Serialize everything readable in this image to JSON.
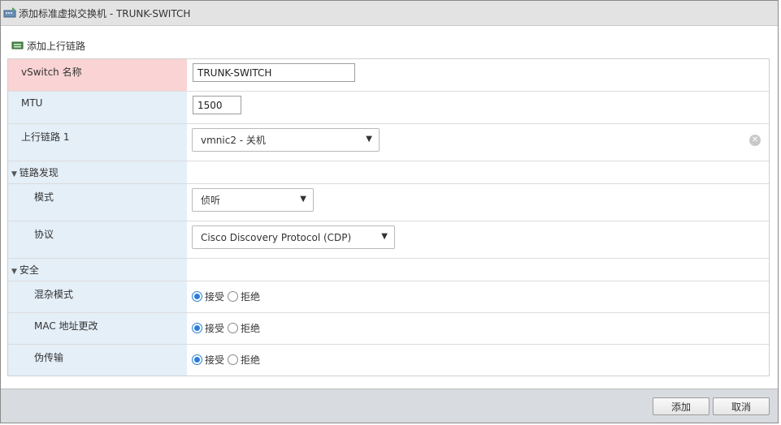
{
  "window": {
    "title": "添加标准虚拟交换机 - TRUNK-SWITCH"
  },
  "toolbar": {
    "add_uplink": "添加上行链路"
  },
  "form": {
    "vswitch_name": {
      "label": "vSwitch 名称",
      "value": "TRUNK-SWITCH"
    },
    "mtu": {
      "label": "MTU",
      "value": "1500"
    },
    "uplink1": {
      "label": "上行链路 1",
      "selected": "vmnic2 - 关机"
    },
    "link_discovery": {
      "label": "链路发现",
      "mode": {
        "label": "模式",
        "selected": "侦听"
      },
      "protocol": {
        "label": "协议",
        "selected": "Cisco Discovery Protocol (CDP)"
      }
    },
    "security": {
      "label": "安全",
      "promiscuous": {
        "label": "混杂模式",
        "accept": "接受",
        "reject": "拒绝",
        "value": "accept"
      },
      "mac_change": {
        "label": "MAC 地址更改",
        "accept": "接受",
        "reject": "拒绝",
        "value": "accept"
      },
      "forged_transmits": {
        "label": "伪传输",
        "accept": "接受",
        "reject": "拒绝",
        "value": "accept"
      }
    }
  },
  "footer": {
    "add": "添加",
    "cancel": "取消"
  },
  "icons": {
    "title": "vswitch-icon",
    "toolbar": "uplink-add-icon",
    "clear": "clear-icon",
    "expand": "triangle-down-icon",
    "dropdown": "dropdown-arrow-icon"
  },
  "colors": {
    "error_label_bg": "#fad4d4",
    "label_bg": "#e4eff8",
    "radio_selected": "#2a7ed8"
  }
}
